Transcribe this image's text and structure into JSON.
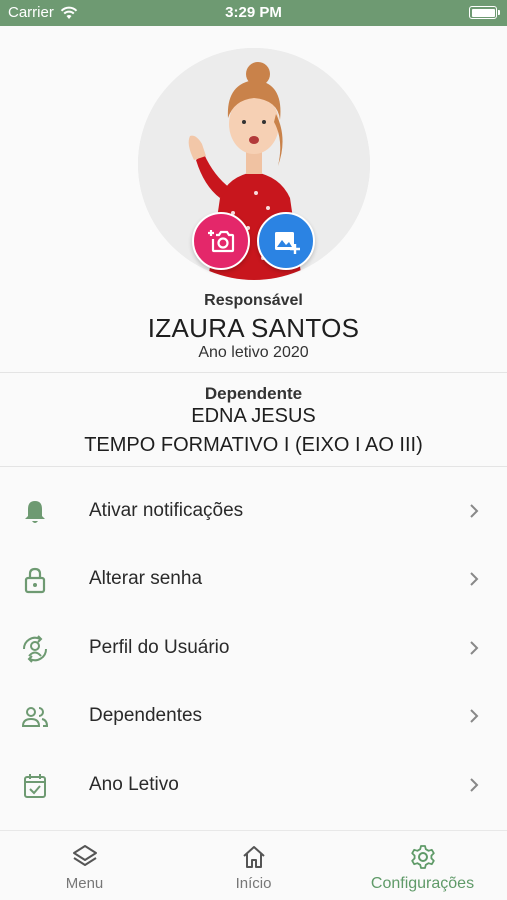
{
  "status_bar": {
    "carrier": "Carrier",
    "time": "3:29 PM"
  },
  "profile": {
    "role_label": "Responsável",
    "name": "IZAURA SANTOS",
    "school_year": "Ano letivo 2020"
  },
  "dependent": {
    "label": "Dependente",
    "name": "EDNA JESUS",
    "class": "TEMPO FORMATIVO I (EIXO I AO III)"
  },
  "menu": [
    {
      "label": "Ativar notificações",
      "icon": "bell-icon"
    },
    {
      "label": "Alterar senha",
      "icon": "lock-icon"
    },
    {
      "label": "Perfil do Usuário",
      "icon": "user-switch-icon"
    },
    {
      "label": "Dependentes",
      "icon": "people-icon"
    },
    {
      "label": "Ano Letivo",
      "icon": "calendar-check-icon"
    }
  ],
  "tab_bar": [
    {
      "label": "Menu",
      "icon": "layers-icon",
      "active": false
    },
    {
      "label": "Início",
      "icon": "home-icon",
      "active": false
    },
    {
      "label": "Configurações",
      "icon": "gear-icon",
      "active": true
    }
  ],
  "colors": {
    "status_bar": "#6e9a72",
    "accent_green": "#5f9a68",
    "camera_button": "#e4276a",
    "gallery_button": "#2b83e3"
  }
}
